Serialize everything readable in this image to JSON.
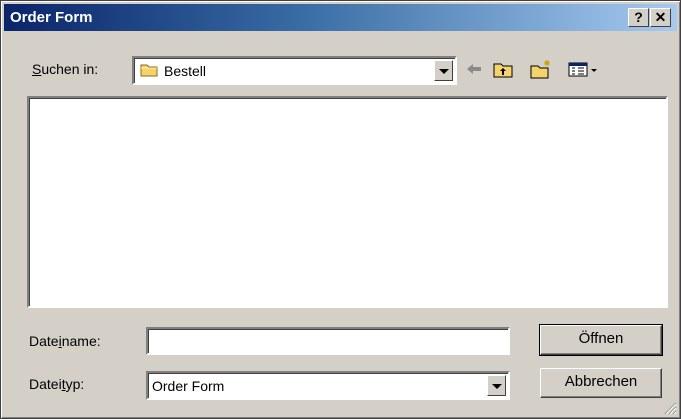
{
  "window": {
    "title": "Order Form"
  },
  "titlebar": {
    "help": "?",
    "close": "✕"
  },
  "lookin": {
    "label_pre": "",
    "label_ul": "S",
    "label_post": "uchen in:",
    "value": "Bestell"
  },
  "toolbar": {
    "back_icon": "back-arrow-icon",
    "up_icon": "up-folder-icon",
    "new_folder_icon": "new-folder-icon",
    "view_icon": "view-menu-icon"
  },
  "filename": {
    "label_pre": "Date",
    "label_ul": "i",
    "label_post": "name:",
    "value": ""
  },
  "filetype": {
    "label_pre": "Datei",
    "label_ul": "t",
    "label_post": "yp:",
    "value": "Order Form"
  },
  "buttons": {
    "open": "Öffnen",
    "cancel": "Abbrechen"
  },
  "colors": {
    "title_start": "#0a246a",
    "title_end": "#a6caf0",
    "face": "#d4d0c8"
  }
}
